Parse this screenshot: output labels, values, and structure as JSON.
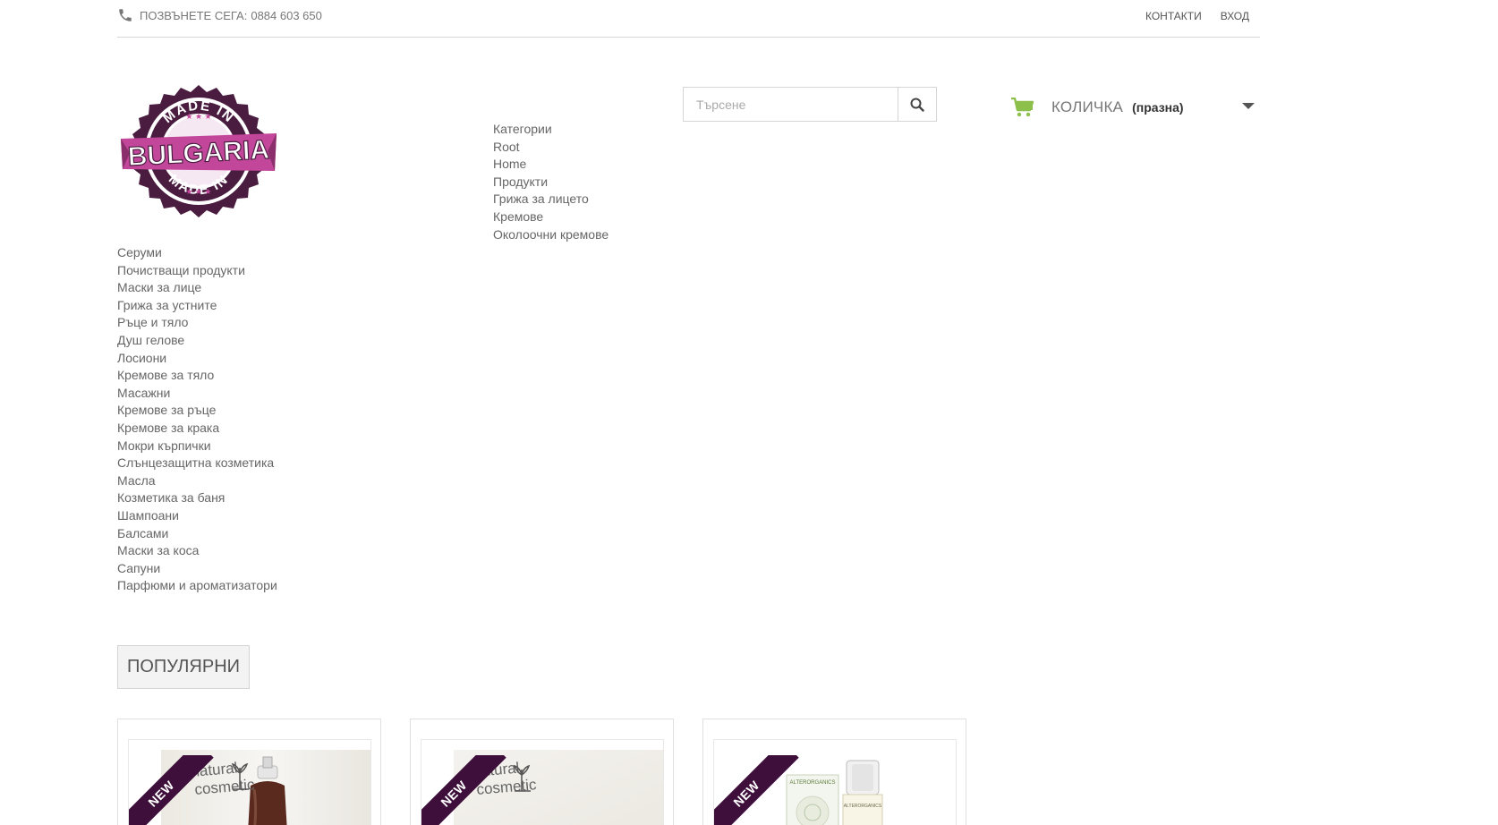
{
  "header": {
    "phone_text": "ПОЗВЪНЕТЕ СЕГА:",
    "phone_number": "0884 603 650",
    "links": {
      "contacts": "КОНТАКТИ",
      "login": "ВХОД"
    }
  },
  "logo": {
    "top_text": "MADE IN",
    "main_text": "BULGARIA",
    "bottom_text": "MADE IN"
  },
  "breadcrumb_menu": [
    "Категории",
    "Root",
    "Home",
    "Продукти",
    "Грижа за лицето",
    "Кремове",
    "Околоочни кремове"
  ],
  "search": {
    "placeholder": "Търсене"
  },
  "cart": {
    "label": "КОЛИЧКА",
    "status": "(празна)"
  },
  "categories": [
    "Серуми",
    "Почистващи продукти",
    "Маски за лице",
    "Грижа за устните",
    "Ръце и тяло",
    "Душ гелове",
    "Лосиони",
    "Кремове за тяло",
    "Масажни",
    "Кремове за ръце",
    "Кремове за крака",
    "Мокри кърпички",
    "Слънцезащитна козметика",
    "Масла",
    "Козметика за баня",
    "Шампоани",
    "Балсами",
    "Маски за коса",
    "Сапуни",
    "Парфюми и ароматизатори"
  ],
  "popular_tab": "ПОПУЛЯРНИ",
  "products": [
    {
      "badge": "NEW",
      "brand_line1": "natural",
      "brand_line2": "cosmetic"
    },
    {
      "badge": "NEW",
      "brand_line1": "natural",
      "brand_line2": "cosmetic"
    },
    {
      "badge": "NEW",
      "brand_line1": "",
      "brand_line2": "",
      "package_text": "ALTERORGANICS"
    }
  ],
  "colors": {
    "accent_cart": "#8cc04b",
    "ribbon": "#3d0f3a",
    "logo_pink": "#c2469a",
    "logo_dark": "#4a1d40"
  }
}
